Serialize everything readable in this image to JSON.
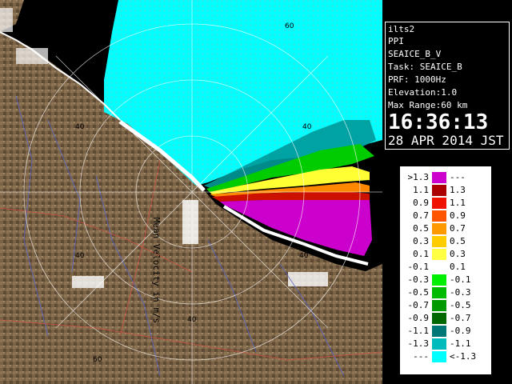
{
  "info": {
    "lines": [
      "ilts2",
      "PPI",
      "SEAICE_B_V",
      "Task: SEAICE_B",
      "PRF: 1000Hz",
      "Elevation:1.0",
      "Max Range:60 km"
    ],
    "time": "16:36:13",
    "date": "28 APR 2014 JST"
  },
  "map": {
    "range_labels": [
      "40",
      "40",
      "40",
      "40",
      "40",
      "60",
      "60",
      "60"
    ]
  },
  "legend": {
    "title": "Mean Velocity in m/s",
    "rows": [
      {
        "lo": ">1.3",
        "hi": "---",
        "color": "#cc00cc"
      },
      {
        "lo": "1.1",
        "hi": "1.3",
        "color": "#aa0000"
      },
      {
        "lo": "0.9",
        "hi": "1.1",
        "color": "#ee1100"
      },
      {
        "lo": "0.7",
        "hi": "0.9",
        "color": "#ff5500"
      },
      {
        "lo": "0.5",
        "hi": "0.7",
        "color": "#ff9900"
      },
      {
        "lo": "0.3",
        "hi": "0.5",
        "color": "#ffcc00"
      },
      {
        "lo": "0.1",
        "hi": "0.3",
        "color": "#ffff44"
      },
      {
        "lo": "-0.1",
        "hi": "0.1",
        "color": "#ffffff"
      },
      {
        "lo": "-0.3",
        "hi": "-0.1",
        "color": "#00ee00"
      },
      {
        "lo": "-0.5",
        "hi": "-0.3",
        "color": "#00bb00"
      },
      {
        "lo": "-0.7",
        "hi": "-0.5",
        "color": "#009900"
      },
      {
        "lo": "-0.9",
        "hi": "-0.7",
        "color": "#006600"
      },
      {
        "lo": "-1.1",
        "hi": "-0.9",
        "color": "#007777"
      },
      {
        "lo": "-1.3",
        "hi": "-1.1",
        "color": "#00bbbb"
      },
      {
        "lo": "---",
        "hi": "<-1.3",
        "color": "#00ffff"
      }
    ]
  }
}
